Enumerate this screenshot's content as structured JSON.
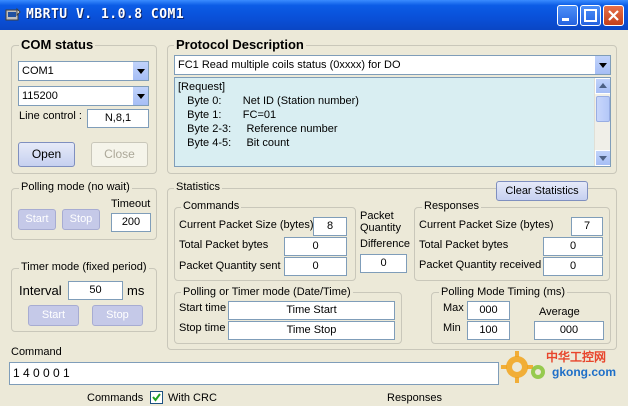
{
  "window": {
    "title": "MBRTU  V. 1.0.8  COM1"
  },
  "com_status": {
    "title": "COM status",
    "port": "COM1",
    "baud": "115200",
    "line_control_label": "Line control :",
    "line_control_value": "N,8,1",
    "open_label": "Open",
    "close_label": "Close"
  },
  "protocol": {
    "title": "Protocol Description",
    "selected": "FC1  Read multiple coils status (0xxxx)  for DO",
    "lines": [
      "[Request]",
      "   Byte 0:       Net ID (Station number)",
      "   Byte 1:       FC=01",
      "   Byte 2-3:     Reference number",
      "   Byte 4-5:     Bit count"
    ]
  },
  "polling": {
    "title": "Polling mode (no wait)",
    "timeout_label": "Timeout",
    "timeout_value": "200",
    "start_label": "Start",
    "stop_label": "Stop"
  },
  "timer": {
    "title": "Timer mode (fixed period)",
    "interval_label": "Interval",
    "interval_value": "50",
    "unit": "ms",
    "start_label": "Start",
    "stop_label": "Stop"
  },
  "statistics": {
    "title": "Statistics",
    "clear_label": "Clear Statistics",
    "commands": {
      "title": "Commands",
      "current_size_label": "Current Packet Size (bytes)",
      "current_size": "8",
      "total_label": "Total Packet bytes",
      "total": "0",
      "quantity_label": "Packet Quantity sent",
      "quantity": "0"
    },
    "difference": {
      "label_line1": "Packet",
      "label_line2": "Quantity",
      "label_line3": "Difference",
      "value": "0"
    },
    "responses": {
      "title": "Responses",
      "current_size_label": "Current Packet Size (bytes)",
      "current_size": "7",
      "total_label": "Total Packet bytes",
      "total": "0",
      "quantity_label": "Packet Quantity received",
      "quantity": "0"
    },
    "timer_time": {
      "title": "Polling  or Timer mode  (Date/Time)",
      "start_label": "Start time",
      "start_value": "Time Start",
      "stop_label": "Stop time",
      "stop_value": "Time Stop"
    },
    "polling_timing": {
      "title": "Polling Mode Timing (ms)",
      "max_label": "Max",
      "max_value": "000",
      "min_label": "Min",
      "min_value": "100",
      "avg_label": "Average",
      "avg_value": "000"
    }
  },
  "command": {
    "label": "Command",
    "value": "1 4 0 0 0 1"
  },
  "bottom": {
    "commands_label": "Commands",
    "with_crc_label": "With CRC",
    "responses_label": "Responses"
  },
  "watermark": {
    "text_cn": "中华工控网",
    "text_en": "gkong.com"
  },
  "colors": {
    "titlebar": "#0A50D8",
    "window_bg": "#ECE9D8",
    "protocol_bg": "#D9EEF2"
  }
}
